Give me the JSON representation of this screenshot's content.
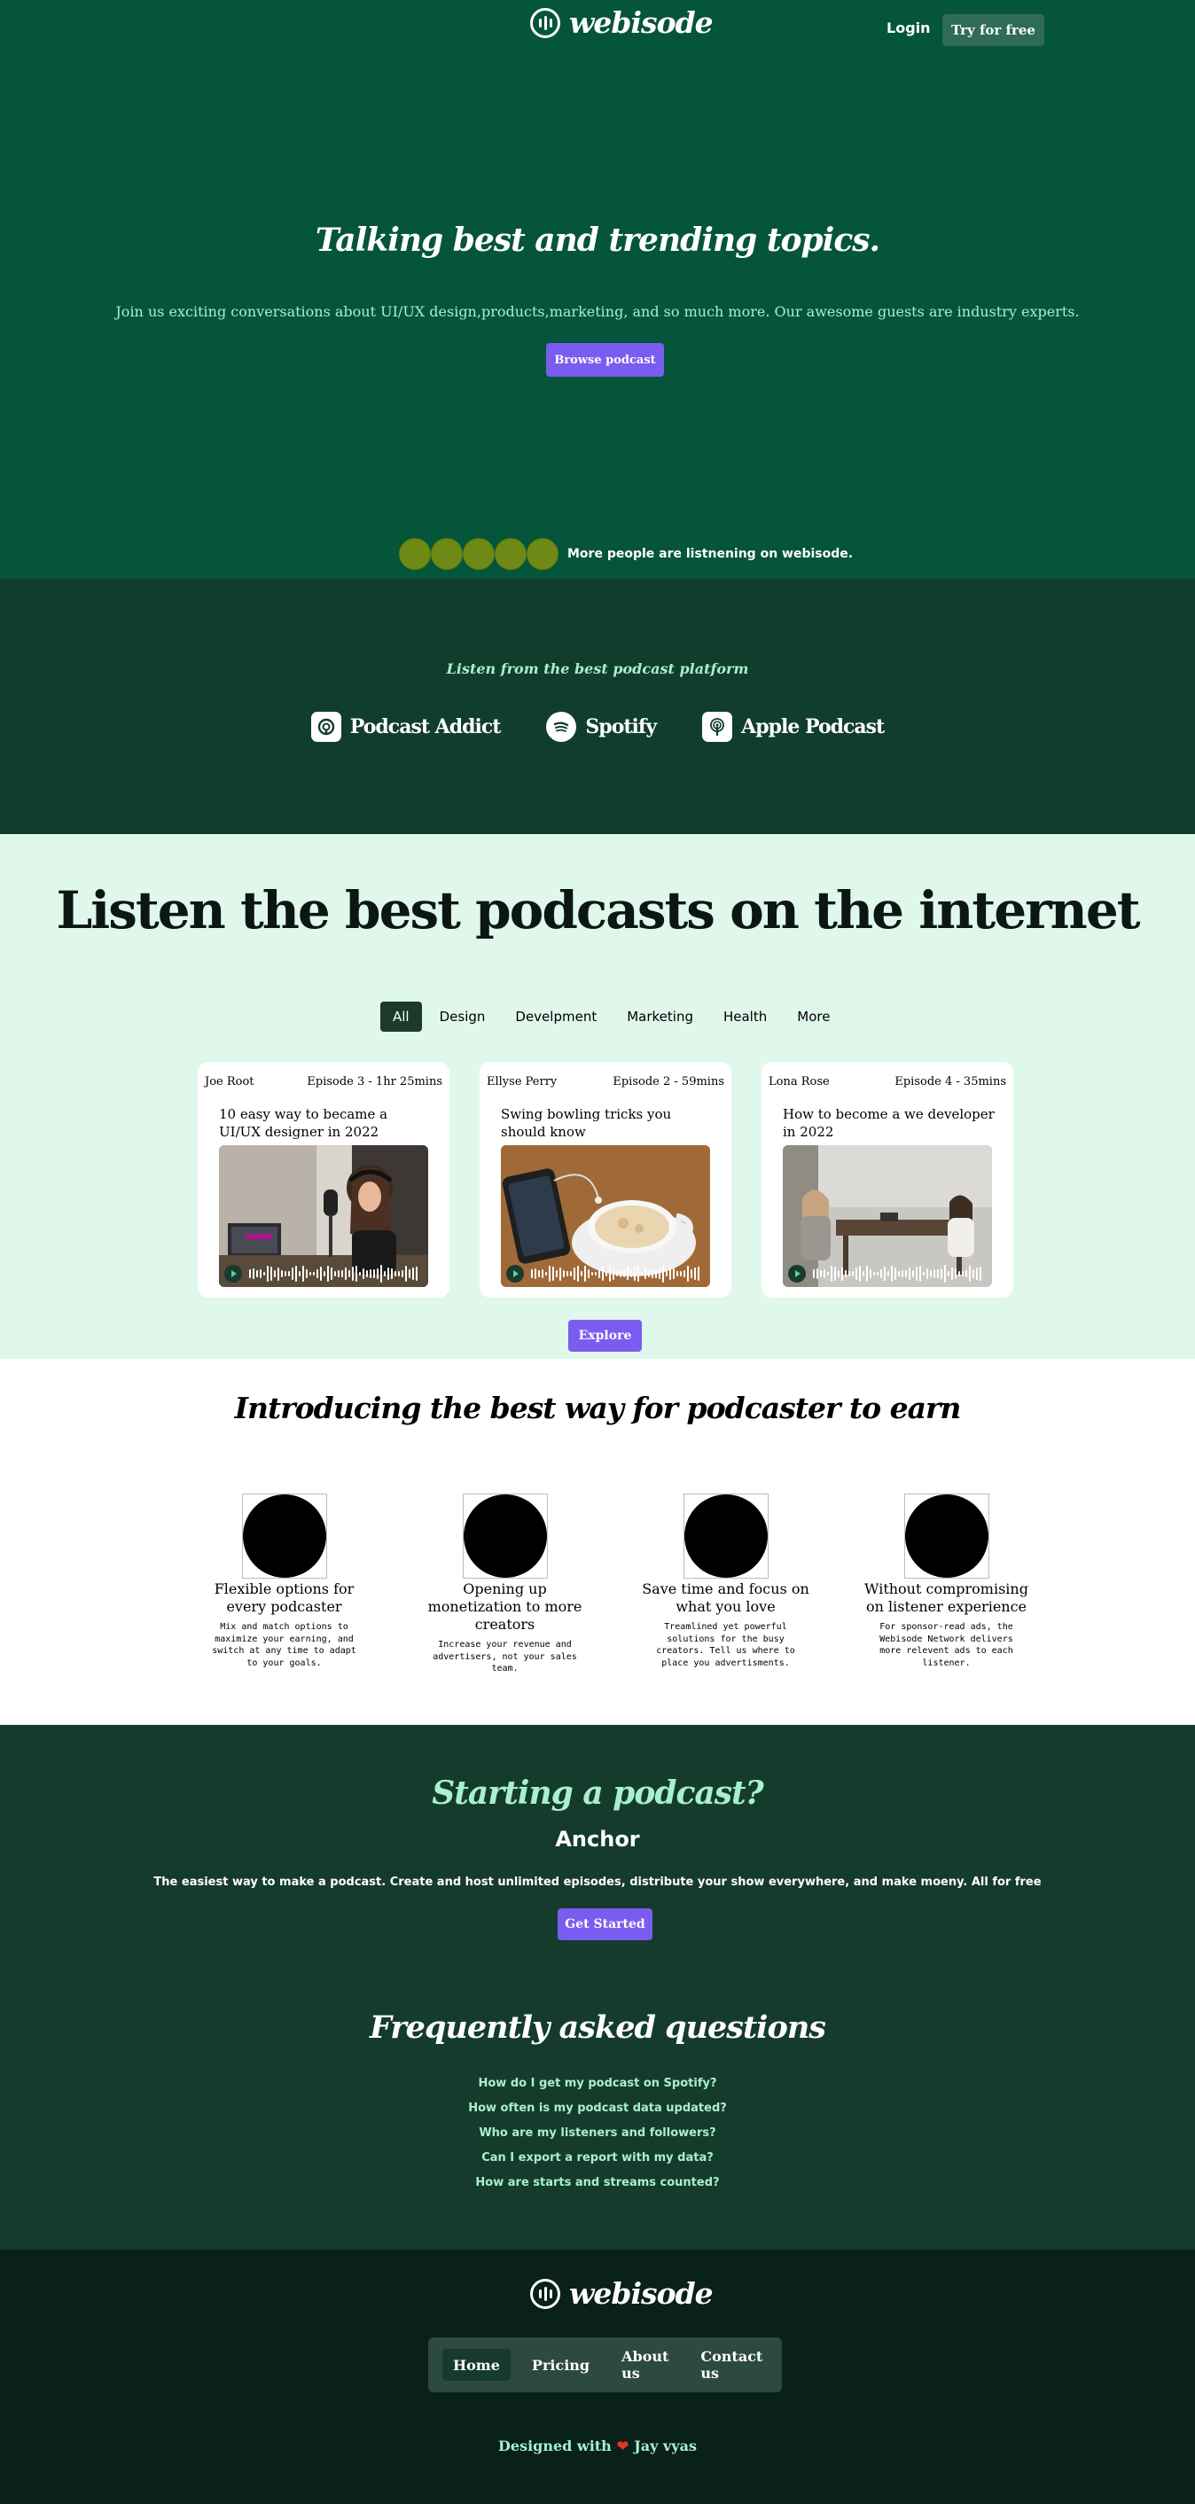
{
  "nav": {
    "logo_text": "webisode",
    "login": "Login",
    "try_free": "Try for free"
  },
  "hero": {
    "title": "Talking best and trending topics.",
    "subtitle": "Join us exciting conversations about UI/UX design,products,marketing, and so much more. Our awesome guests are industry experts.",
    "cta": "Browse podcast",
    "listeners_text": "More people are listnening on webisode."
  },
  "platforms": {
    "title": "Listen from the best podcast platform",
    "items": [
      {
        "label": "Podcast Addict",
        "icon": "podcast-addict-icon"
      },
      {
        "label": "Spotify",
        "icon": "spotify-icon"
      },
      {
        "label": "Apple Podcast",
        "icon": "apple-podcast-icon"
      }
    ]
  },
  "listen": {
    "title": "Listen the best podcasts on the internet",
    "tabs": [
      "All",
      "Design",
      "Develpment",
      "Marketing",
      "Health",
      "More"
    ],
    "active_tab": "All",
    "cards": [
      {
        "author": "Joe Root",
        "episode": "Episode 3 - 1hr 25mins",
        "title": "10 easy way to became a UI/UX designer in 2022"
      },
      {
        "author": "Ellyse Perry",
        "episode": "Episode 2 - 59mins",
        "title": "Swing bowling tricks you should know"
      },
      {
        "author": "Lona Rose",
        "episode": "Episode 4 - 35mins",
        "title": "How to become a we developer in 2022"
      }
    ],
    "explore": "Explore"
  },
  "earn": {
    "title": "Introducing the best way for podcaster to earn",
    "features": [
      {
        "title": "Flexible options for every podcaster",
        "desc": "Mix and match options to maximize your earning, and switch at any time to adapt to your goals."
      },
      {
        "title": "Opening up monetization to more creators",
        "desc": "Increase your revenue and advertisers, not your sales team."
      },
      {
        "title": "Save time and focus on what you love",
        "desc": "Treamlined yet powerful solutions for the busy creators. Tell us where to place you advertisments."
      },
      {
        "title": "Without compromising on listener experience",
        "desc": "For sponsor-read ads, the Webisode Network delivers more relevent ads to each listener."
      }
    ]
  },
  "anchor": {
    "title": "Starting a podcast?",
    "subtitle": "Anchor",
    "desc": "The easiest way to make a podcast. Create and host unlimited episodes, distribute your show everywhere, and make moeny. All for free",
    "cta": "Get Started"
  },
  "faq": {
    "title": "Frequently asked questions",
    "items": [
      "How do I get my podcast on Spotify?",
      "How often is my podcast data updated?",
      "Who are my listeners and followers?",
      "Can I export a report with my data?",
      "How are starts and streams counted?"
    ]
  },
  "footer": {
    "logo_text": "webisode",
    "links": [
      "Home",
      "Pricing",
      "About us",
      "Contact us"
    ],
    "active_link": "Home",
    "credit_prefix": "Designed with",
    "credit_author": "Jay vyas"
  },
  "colors": {
    "hero_bg": "#05553a",
    "accent": "#7b5cf0",
    "mint": "#a8f0cf",
    "light_bg": "#e0f7ec"
  }
}
